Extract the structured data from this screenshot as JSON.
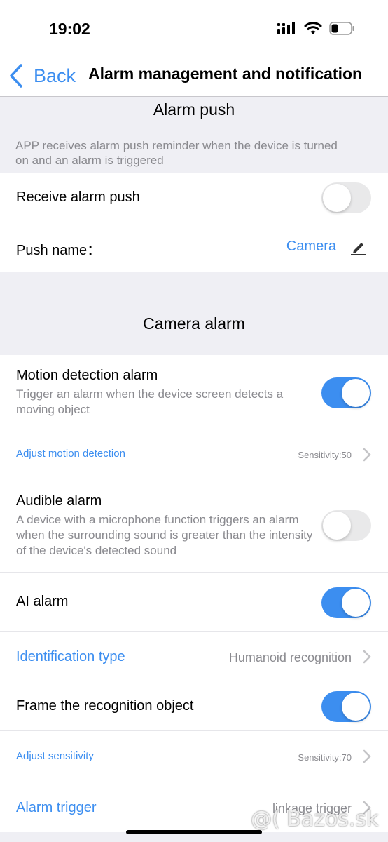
{
  "status_bar": {
    "time": "19:02"
  },
  "nav": {
    "back_label": "Back",
    "title": "Alarm management and notification"
  },
  "alarm_push": {
    "section_title": "Alarm push",
    "description": "APP receives alarm push reminder when the device is turned on and an alarm is triggered",
    "receive_push": {
      "label": "Receive alarm push",
      "enabled": false
    },
    "push_name": {
      "label": "Push name：",
      "value": "Camera"
    }
  },
  "camera_alarm": {
    "section_title": "Camera alarm",
    "motion_detection": {
      "label": "Motion detection alarm",
      "description": "Trigger an alarm when the device screen detects a moving object",
      "enabled": true
    },
    "adjust_motion": {
      "label": "Adjust motion detection",
      "value": "Sensitivity:50"
    },
    "audible": {
      "label": "Audible alarm",
      "description": "A device with a microphone function triggers an alarm when the surrounding sound is greater than the intensity of the device's detected sound",
      "enabled": false
    },
    "ai_alarm": {
      "label": "AI alarm",
      "enabled": true
    },
    "identification_type": {
      "label": "Identification type",
      "value": "Humanoid recognition"
    },
    "frame_object": {
      "label": "Frame the recognition object",
      "enabled": true
    },
    "adjust_sensitivity": {
      "label": "Adjust sensitivity",
      "value": "Sensitivity:70"
    },
    "alarm_trigger": {
      "label": "Alarm trigger",
      "value": "linkage trigger"
    }
  },
  "watermark": "@( Bazos.sk",
  "colors": {
    "accent": "#3c8ef0",
    "background": "#efeff4"
  }
}
